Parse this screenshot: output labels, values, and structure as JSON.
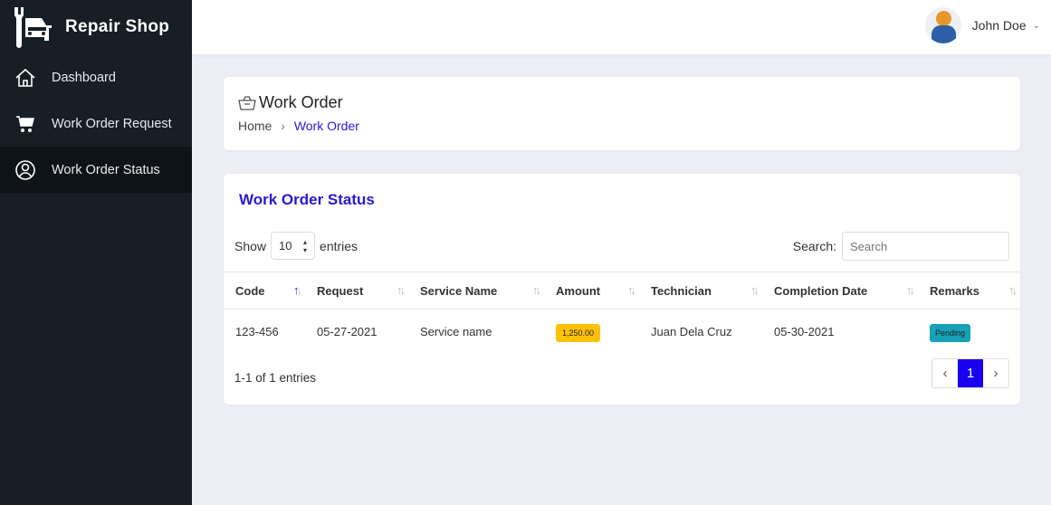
{
  "brand": {
    "name": "Repair Shop",
    "logo_icon": "wrench-car-icon"
  },
  "sidebar": {
    "items": [
      {
        "label": "Dashboard",
        "icon": "home-icon"
      },
      {
        "label": "Work Order Request",
        "icon": "cart-icon"
      },
      {
        "label": "Work Order Status",
        "icon": "user-circle-icon",
        "active": true
      }
    ]
  },
  "header": {
    "user_name": "John Doe"
  },
  "page": {
    "title": "Work Order",
    "breadcrumb": [
      "Home",
      "Work Order"
    ]
  },
  "table_section": {
    "title": "Work Order Status",
    "show_label": "Show",
    "entries_label": "entries",
    "page_size": "10",
    "search_label": "Search:",
    "search_placeholder": "Search",
    "search_value": "",
    "columns": [
      "Code",
      "Request",
      "Service Name",
      "Amount",
      "Technician",
      "Completion Date",
      "Remarks"
    ],
    "rows": [
      {
        "code": "123-456",
        "request": "05-27-2021",
        "service": "Service name",
        "amount": "1,250.00",
        "technician": "Juan Dela Cruz",
        "completion": "05-30-2021",
        "remarks": "Pending"
      }
    ],
    "info": "1-1 of 1 entries",
    "pages": [
      "1"
    ],
    "current_page": "1"
  },
  "colors": {
    "accent": "#2a18d8",
    "sidebar": "#171e25",
    "amount_badge": "#ffc107",
    "pending_badge": "#17a2b8",
    "page_active": "#1a00f0"
  }
}
